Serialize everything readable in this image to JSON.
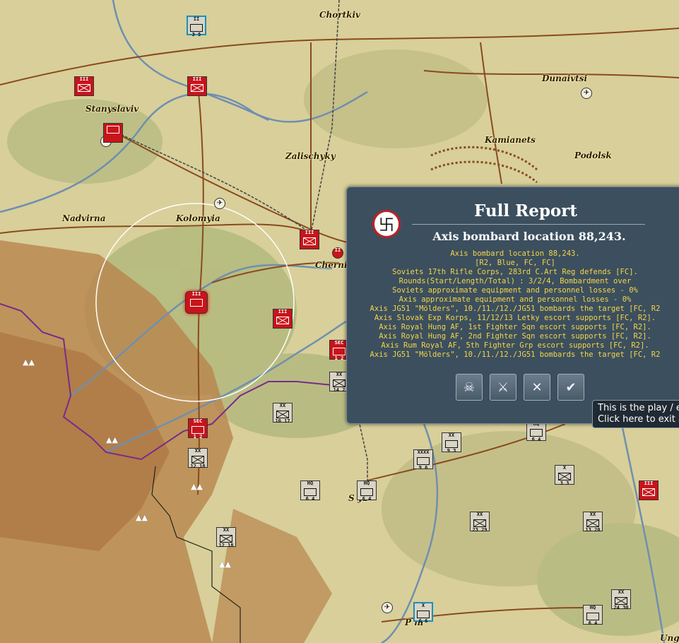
{
  "towns": [
    {
      "id": "chortkiv",
      "name": "Chortkiv"
    },
    {
      "id": "dunaivtsi",
      "name": "Dunaivtsi"
    },
    {
      "id": "stanyslaviv",
      "name": "Stanyslaviv"
    },
    {
      "id": "kamianets",
      "name": "Kamianets"
    },
    {
      "id": "zalischyky",
      "name": "Zalischyky"
    },
    {
      "id": "podolsk",
      "name": "Podolsk"
    },
    {
      "id": "nadvirna",
      "name": "Nadvirna"
    },
    {
      "id": "kolomyia",
      "name": "Kolomyia"
    },
    {
      "id": "cherni",
      "name": "Cherni"
    },
    {
      "id": "sya",
      "name": "S    ya"
    },
    {
      "id": "pni",
      "name": "P      ni"
    },
    {
      "id": "ung",
      "name": "Ung"
    }
  ],
  "units": [
    {
      "id": "u1",
      "side": "sov",
      "label": "II",
      "str": "3 5",
      "frame": true
    },
    {
      "id": "u2",
      "side": "axis",
      "label": "III",
      "str": ""
    },
    {
      "id": "u3",
      "side": "axis",
      "label": "III",
      "str": ""
    },
    {
      "id": "u4",
      "side": "axis",
      "label": "",
      "str": ""
    },
    {
      "id": "u5",
      "side": "axis",
      "label": "III",
      "str": ""
    },
    {
      "id": "u6",
      "side": "axis",
      "label": "III",
      "str": ""
    },
    {
      "id": "u7",
      "side": "axis",
      "label": "III",
      "str": ""
    },
    {
      "id": "u8",
      "side": "axis",
      "label": "SEC",
      "str": "1 2"
    },
    {
      "id": "u9",
      "side": "axis",
      "label": "SEC",
      "str": "1 2"
    },
    {
      "id": "u10",
      "side": "sov",
      "label": "XX",
      "str": "12 18"
    },
    {
      "id": "u11",
      "side": "sov",
      "label": "XX",
      "str": "10 17"
    },
    {
      "id": "u12",
      "side": "sov",
      "label": "XX",
      "str": "14 2"
    },
    {
      "id": "u13",
      "side": "sov",
      "label": "XX",
      "str": "12 18"
    },
    {
      "id": "u14",
      "side": "sov",
      "label": "HQ",
      "str": "6 4"
    },
    {
      "id": "u15",
      "side": "sov",
      "label": "HQ",
      "str": "6 4"
    },
    {
      "id": "u16",
      "side": "sov",
      "label": "XXXX",
      "str": "9 6"
    },
    {
      "id": "u17",
      "side": "sov",
      "label": "XX",
      "str": "9 3"
    },
    {
      "id": "u18",
      "side": "sov",
      "label": "HQ",
      "str": "6 4"
    },
    {
      "id": "u19",
      "side": "sov",
      "label": "X",
      "str": "3 3"
    },
    {
      "id": "u20",
      "side": "sov",
      "label": "XX",
      "str": "23 29"
    },
    {
      "id": "u21",
      "side": "sov",
      "label": "XX",
      "str": "13 20"
    },
    {
      "id": "u22",
      "side": "axis",
      "label": "III",
      "str": ""
    },
    {
      "id": "u23",
      "side": "sov",
      "label": "XX",
      "str": "24 30"
    },
    {
      "id": "u24",
      "side": "sov",
      "label": "HQ",
      "str": "6 4"
    },
    {
      "id": "u25",
      "side": "sov",
      "label": "X",
      "str": "6 6"
    },
    {
      "id": "u26",
      "side": "axis",
      "label": "II",
      "str": ""
    }
  ],
  "report": {
    "title": "Full Report",
    "subtitle": "Axis bombard location 88,243.",
    "lines": [
      "Axis bombard location 88,243.",
      "[R2, Blue, FC, FC]",
      "Soviets 17th Rifle Corps, 283rd C.Art Reg defends [FC].",
      "Rounds(Start/Length/Total) : 3/2/4, Bombardment over",
      "Soviets approximate equipment and personnel losses - 0%",
      "Axis approximate equipment and personnel losses - 0%",
      "Axis JG51 \"Mölders\", 10./11./12./JG51 bombards the target [FC, R2",
      "Axis Slovak Exp Korps, 11/12/13 Letky escort supports [FC, R2].",
      "Axis Royal Hung AF, 1st Fighter Sqn escort supports [FC, R2].",
      "Axis Royal Hung AF, 2nd Fighter Sqn escort supports [FC, R2].",
      "Axis Rum Royal AF, 5th Fighter Grp escort supports [FC, R2].",
      "Axis JG51 \"Mölders\", 10./11./12./JG51 bombards the target [FC, R2"
    ],
    "buttons": [
      {
        "id": "defender-losses",
        "icon": "shield-skull-icon",
        "glyph": "☠"
      },
      {
        "id": "attacker-losses",
        "icon": "sword-skull-icon",
        "glyph": "⚔"
      },
      {
        "id": "combat-map",
        "icon": "crossed-arrows-icon",
        "glyph": "✕"
      },
      {
        "id": "confirm",
        "icon": "checkmark-icon",
        "glyph": "✔"
      }
    ]
  },
  "tooltip": {
    "line1": "This is the play / e",
    "line2": "Click here to exit a"
  },
  "colors": {
    "axis_unit": "#c8141b",
    "soviet_unit": "#d9d4c4",
    "panel_bg": "#3c4f5e",
    "report_text": "#f3d54a",
    "front_line": "#7a2a8a",
    "river": "#6f8fb0",
    "road": "#8a4a1c"
  }
}
